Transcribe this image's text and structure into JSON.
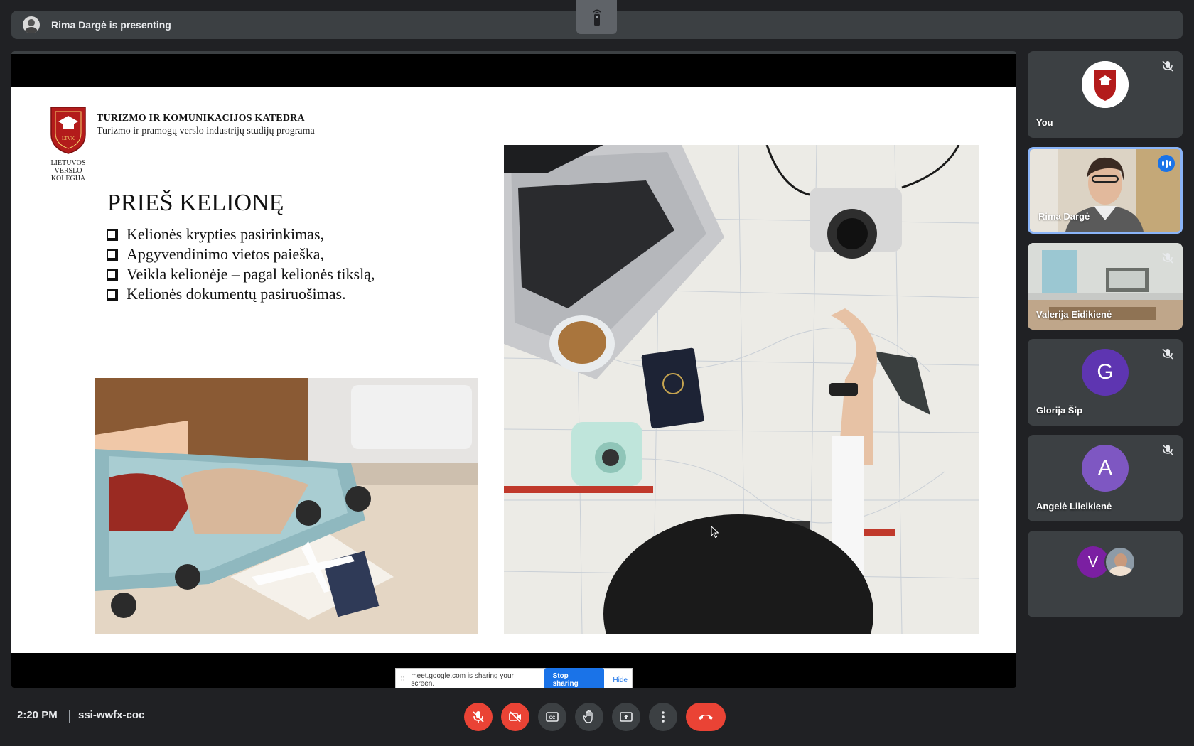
{
  "presenting": {
    "text": "Rima Dargė is presenting"
  },
  "slide": {
    "college": [
      "LIETUVOS",
      "VERSLO",
      "KOLEGIJA"
    ],
    "logo_text": "LTVK",
    "department": "TURIZMO IR KOMUNIKACIJOS KATEDRA",
    "program": "Turizmo ir pramogų verslo industrijų studijų programa",
    "title": "PRIEŠ KELIONĘ",
    "bullets": [
      "Kelionės krypties pasirinkimas,",
      "Apgyvendinimo vietos paieška,",
      "Veikla kelionėje – pagal kelionės tikslą,",
      "Kelionės dokumentų pasiruošimas."
    ]
  },
  "share_bar": {
    "message": "meet.google.com is sharing your screen.",
    "stop_label": "Stop sharing",
    "hide_label": "Hide"
  },
  "participants": [
    {
      "name": "You",
      "type": "logo",
      "muted": true
    },
    {
      "name": "Rima Dargė",
      "type": "video",
      "speaking": true
    },
    {
      "name": "Valerija Eidikienė",
      "type": "video",
      "muted": true
    },
    {
      "name": "Glorija Šip",
      "type": "initial",
      "initial": "G",
      "color": "#5e35b1",
      "muted": true
    },
    {
      "name": "Angelė Lileikienė",
      "type": "initial",
      "initial": "A",
      "color": "#7e57c2",
      "muted": true
    },
    {
      "name": "",
      "type": "group",
      "initial": "V",
      "color": "#7b1fa2"
    }
  ],
  "bottom": {
    "time": "2:20 PM",
    "meeting_code": "ssi-wwfx-coc"
  },
  "colors": {
    "background": "#202124",
    "surface": "#3c4043",
    "danger": "#ea4335",
    "accent": "#1a73e8"
  }
}
